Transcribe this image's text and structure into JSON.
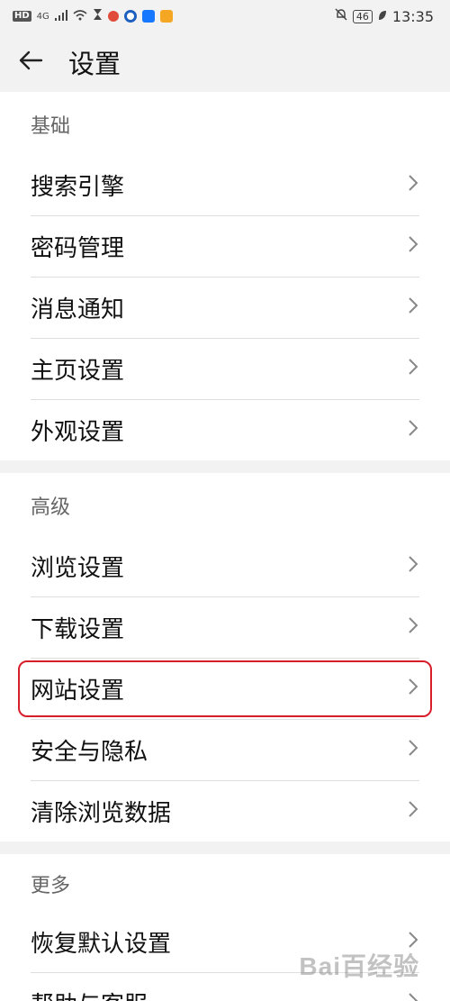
{
  "status_bar": {
    "hd": "HD",
    "network": "4G",
    "battery": "46",
    "time": "13:35"
  },
  "header": {
    "title": "设置"
  },
  "sections": [
    {
      "header": "基础",
      "items": [
        {
          "label": "搜索引擎"
        },
        {
          "label": "密码管理"
        },
        {
          "label": "消息通知"
        },
        {
          "label": "主页设置"
        },
        {
          "label": "外观设置"
        }
      ]
    },
    {
      "header": "高级",
      "items": [
        {
          "label": "浏览设置"
        },
        {
          "label": "下载设置"
        },
        {
          "label": "网站设置",
          "highlighted": true
        },
        {
          "label": "安全与隐私"
        },
        {
          "label": "清除浏览数据"
        }
      ]
    },
    {
      "header": "更多",
      "items": [
        {
          "label": "恢复默认设置"
        },
        {
          "label": "帮助与客服"
        }
      ]
    }
  ],
  "watermark": "Bai百经验",
  "colors": {
    "highlight_border": "#d81e2a",
    "background": "#f2f2f2"
  },
  "icons": {
    "back": "arrow-left-icon",
    "row_chevron": "chevron-right-icon"
  }
}
